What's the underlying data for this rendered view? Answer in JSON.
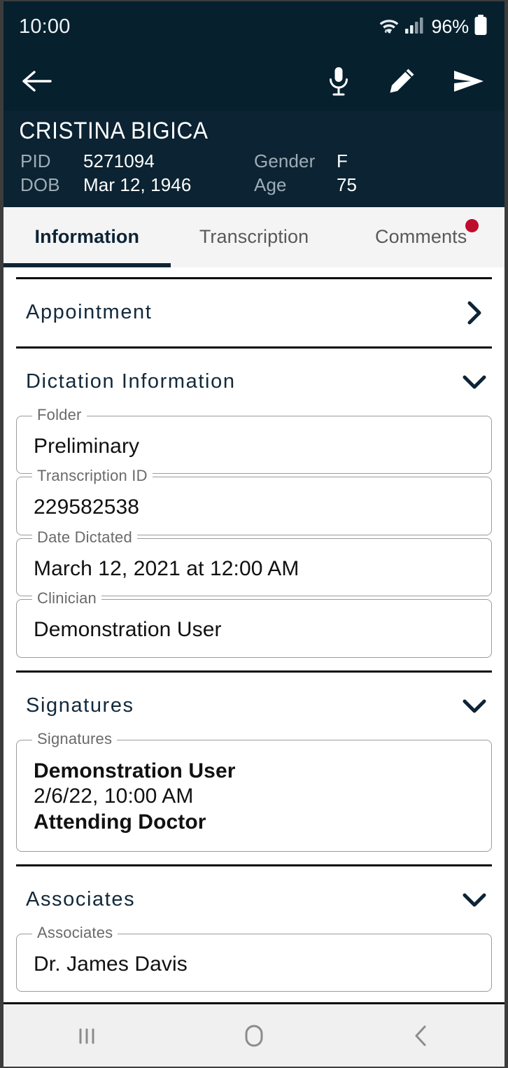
{
  "status_bar": {
    "time": "10:00",
    "battery_percent": "96%",
    "wifi_icon": "wifi-icon",
    "signal_icon": "cellular-signal-icon",
    "battery_icon": "battery-icon"
  },
  "app_bar": {
    "back_icon": "back-arrow-icon",
    "actions": [
      {
        "icon": "microphone-icon",
        "name": "record-dictation-button"
      },
      {
        "icon": "pencil-icon",
        "name": "edit-button"
      },
      {
        "icon": "send-icon",
        "name": "send-button"
      }
    ]
  },
  "patient": {
    "name": "CRISTINA BIGICA",
    "pid_label": "PID",
    "pid_value": "5271094",
    "dob_label": "DOB",
    "dob_value": "Mar 12, 1946",
    "gender_label": "Gender",
    "gender_value": "F",
    "age_label": "Age",
    "age_value": "75"
  },
  "tabs": [
    {
      "label": "Information",
      "active": true,
      "badge": false
    },
    {
      "label": "Transcription",
      "active": false,
      "badge": false
    },
    {
      "label": "Comments",
      "active": false,
      "badge": true
    }
  ],
  "sections": {
    "appointment": {
      "title": "Appointment",
      "chevron": "chevron-right-icon"
    },
    "dictation": {
      "title": "Dictation Information",
      "chevron": "chevron-down-icon",
      "fields": [
        {
          "label": "Folder",
          "value": "Preliminary"
        },
        {
          "label": "Transcription ID",
          "value": "229582538"
        },
        {
          "label": "Date Dictated",
          "value": "March 12, 2021 at 12:00 AM"
        },
        {
          "label": "Clinician",
          "value": "Demonstration User"
        }
      ]
    },
    "signatures": {
      "title": "Signatures",
      "chevron": "chevron-down-icon",
      "field_label": "Signatures",
      "signer_name": "Demonstration User",
      "signed_at": "2/6/22, 10:00 AM",
      "signer_role": "Attending Doctor"
    },
    "associates": {
      "title": "Associates",
      "chevron": "chevron-down-icon",
      "field_label": "Associates",
      "value": "Dr. James Davis"
    }
  },
  "nav_bar": {
    "recents_icon": "recents-icon",
    "home_icon": "home-icon",
    "back_icon": "system-back-icon"
  },
  "colors": {
    "header_bg": "#06202e",
    "patient_bg": "#0b2332",
    "accent": "#0e2436",
    "badge_red": "#bf0d2e",
    "tab_bg": "#f4f4f4",
    "field_border": "#9b9b9b"
  }
}
